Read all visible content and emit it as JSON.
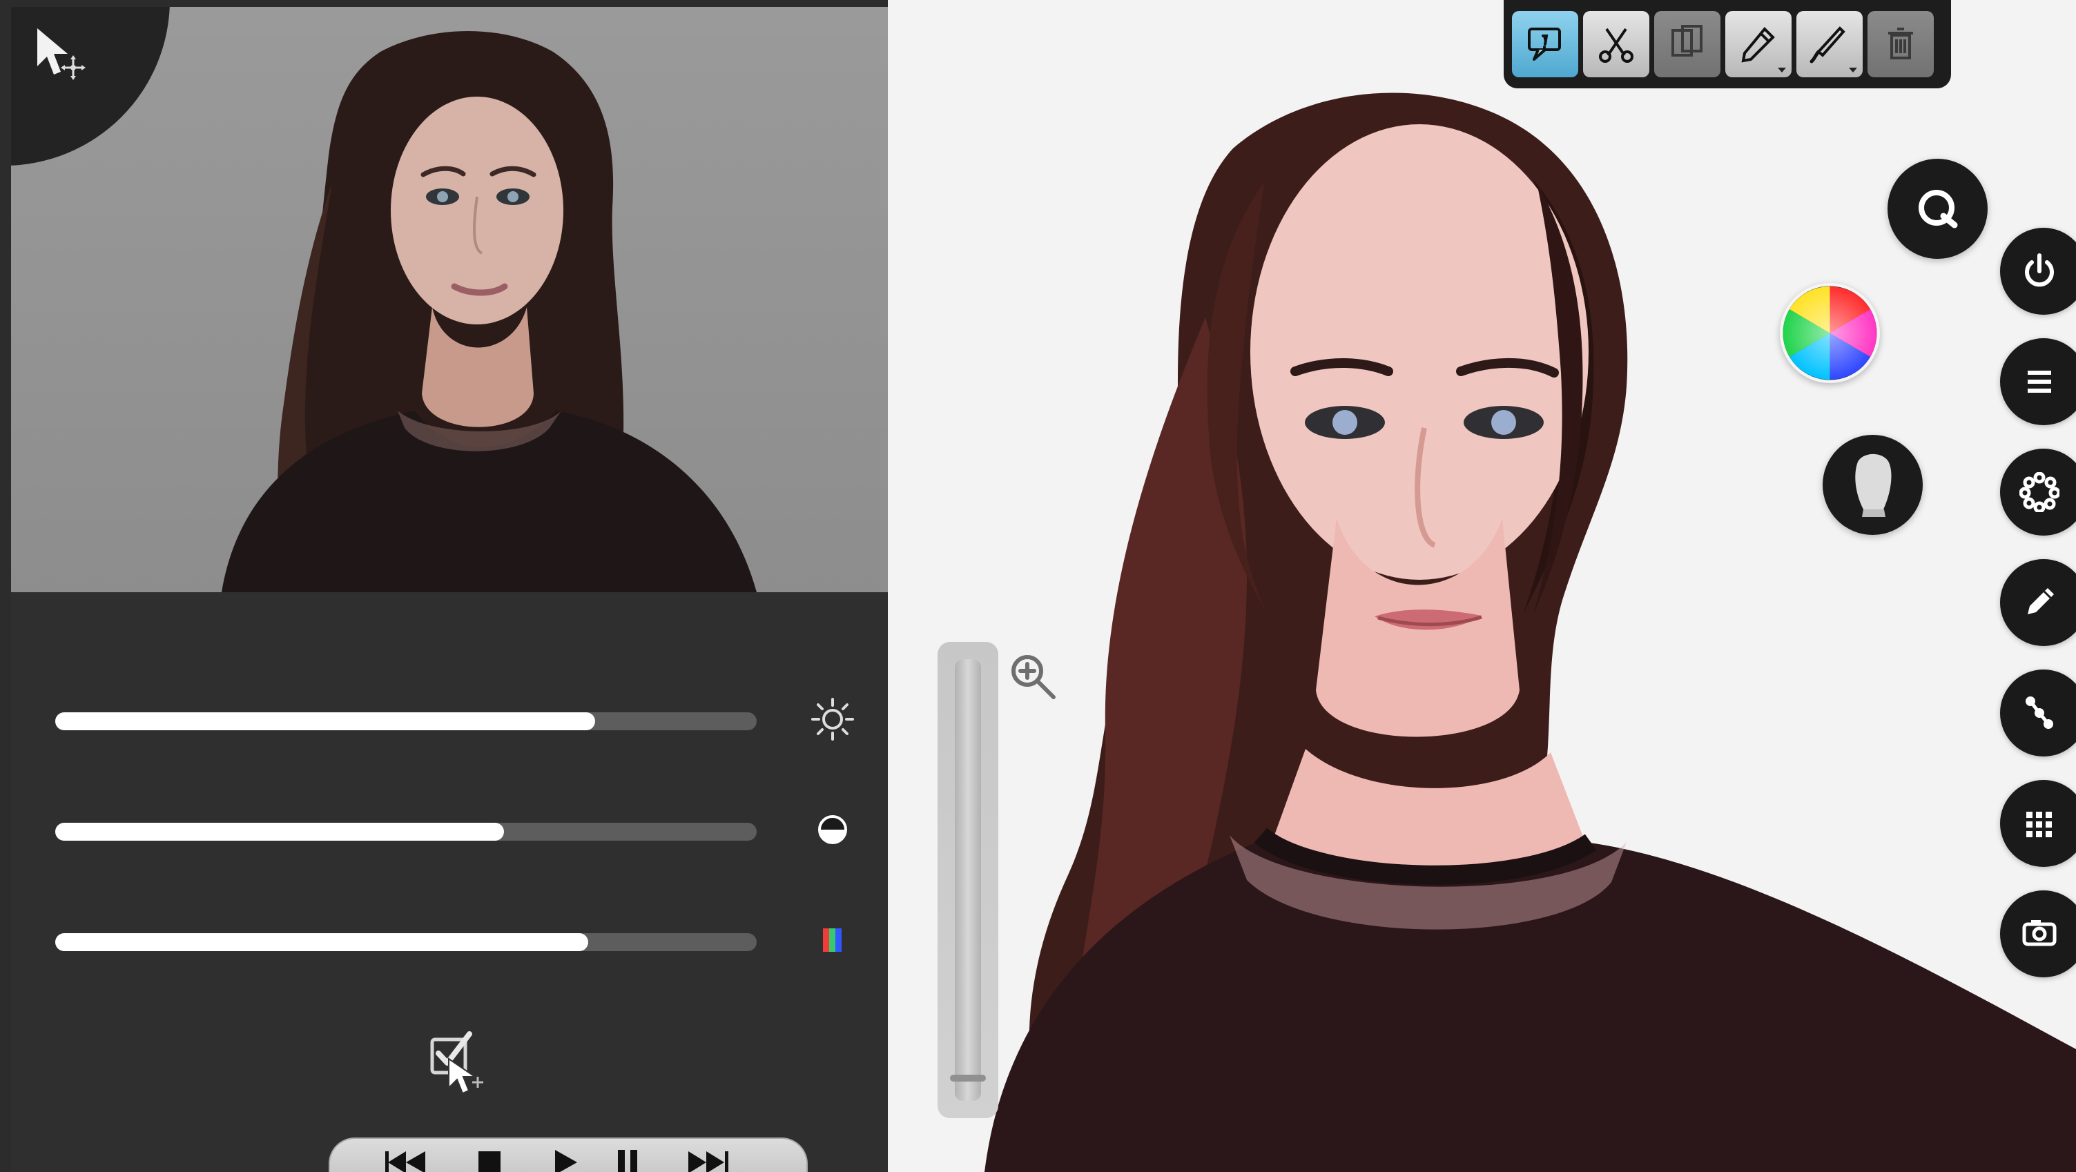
{
  "left_panel": {
    "corner_icon": "cursor-move-icon",
    "adjustments": [
      {
        "name": "brightness",
        "icon": "sun-icon",
        "value": 0.77
      },
      {
        "name": "contrast",
        "icon": "contrast-icon",
        "value": 0.64
      },
      {
        "name": "saturation",
        "icon": "color-icon",
        "value": 0.76
      }
    ],
    "checkbox_checked": true,
    "playback_controls": [
      "rewind-icon",
      "stop-icon",
      "play-icon",
      "pause-icon",
      "fast-forward-icon"
    ]
  },
  "main_view": {
    "toolbar": [
      "comment-icon",
      "scissors-icon",
      "copy-icon",
      "eyedropper-icon",
      "brush-icon",
      "trash-icon"
    ],
    "active_tool": "comment-icon",
    "right_dock": [
      "power-icon",
      "list-icon",
      "dots-circle-icon",
      "pen-icon",
      "nodes-icon",
      "grid-icon",
      "camera-icon"
    ],
    "floating_controls": [
      "quick-select-icon",
      "color-wheel-icon",
      "head-mask-icon"
    ],
    "zoom_level": 0.06,
    "accent_color": "#59b7dc"
  }
}
